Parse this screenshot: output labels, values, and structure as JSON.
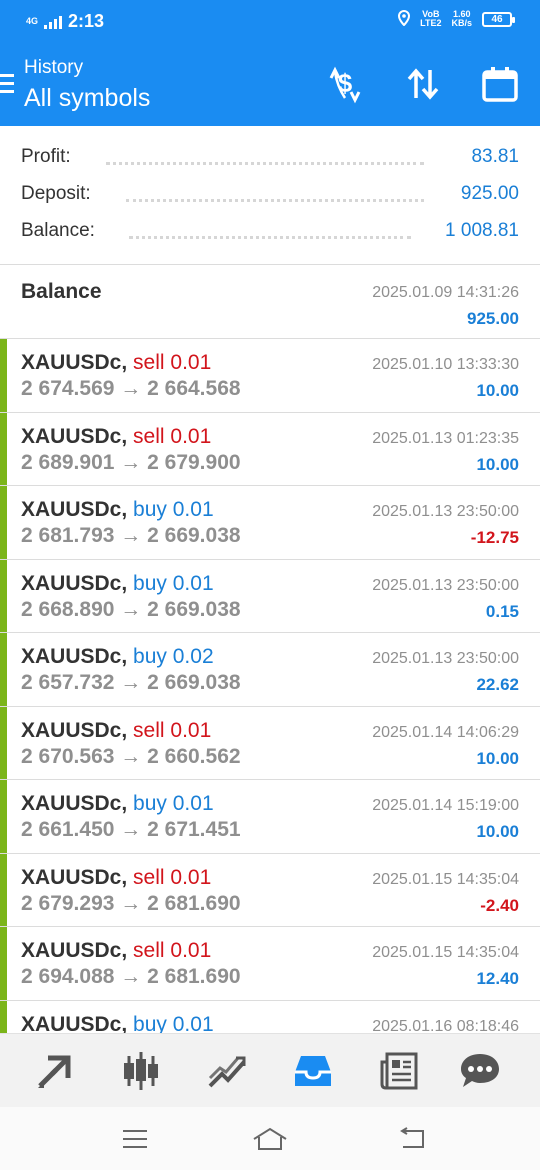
{
  "status_bar": {
    "network": "4G",
    "time": "2:13",
    "volte": "VoB\nLTE2",
    "speed": "1.60\nKB/s",
    "battery": "46"
  },
  "header": {
    "subtitle": "History",
    "title": "All symbols",
    "icons": [
      "currency-exchange-icon",
      "sort-arrows-icon",
      "calendar-icon"
    ]
  },
  "summary": {
    "profit_label": "Profit:",
    "profit_value": "83.81",
    "deposit_label": "Deposit:",
    "deposit_value": "925.00",
    "balance_label": "Balance:",
    "balance_value": "1 008.81"
  },
  "balance_entry": {
    "title": "Balance",
    "time": "2025.01.09 14:31:26",
    "amount": "925.00"
  },
  "trades": [
    {
      "symbol": "XAUUSDc,",
      "side": "sell",
      "volume": "0.01",
      "open": "2 674.569",
      "arrow": "→",
      "close": "2 664.568",
      "time": "2025.01.10 13:33:30",
      "profit": "10.00"
    },
    {
      "symbol": "XAUUSDc,",
      "side": "sell",
      "volume": "0.01",
      "open": "2 689.901",
      "arrow": "→",
      "close": "2 679.900",
      "time": "2025.01.13 01:23:35",
      "profit": "10.00"
    },
    {
      "symbol": "XAUUSDc,",
      "side": "buy",
      "volume": "0.01",
      "open": "2 681.793",
      "arrow": "→",
      "close": "2 669.038",
      "time": "2025.01.13 23:50:00",
      "profit": "-12.75"
    },
    {
      "symbol": "XAUUSDc,",
      "side": "buy",
      "volume": "0.01",
      "open": "2 668.890",
      "arrow": "→",
      "close": "2 669.038",
      "time": "2025.01.13 23:50:00",
      "profit": "0.15"
    },
    {
      "symbol": "XAUUSDc,",
      "side": "buy",
      "volume": "0.02",
      "open": "2 657.732",
      "arrow": "→",
      "close": "2 669.038",
      "time": "2025.01.13 23:50:00",
      "profit": "22.62"
    },
    {
      "symbol": "XAUUSDc,",
      "side": "sell",
      "volume": "0.01",
      "open": "2 670.563",
      "arrow": "→",
      "close": "2 660.562",
      "time": "2025.01.14 14:06:29",
      "profit": "10.00"
    },
    {
      "symbol": "XAUUSDc,",
      "side": "buy",
      "volume": "0.01",
      "open": "2 661.450",
      "arrow": "→",
      "close": "2 671.451",
      "time": "2025.01.14 15:19:00",
      "profit": "10.00"
    },
    {
      "symbol": "XAUUSDc,",
      "side": "sell",
      "volume": "0.01",
      "open": "2 679.293",
      "arrow": "→",
      "close": "2 681.690",
      "time": "2025.01.15 14:35:04",
      "profit": "-2.40"
    },
    {
      "symbol": "XAUUSDc,",
      "side": "sell",
      "volume": "0.01",
      "open": "2 694.088",
      "arrow": "→",
      "close": "2 681.690",
      "time": "2025.01.15 14:35:04",
      "profit": "12.40"
    },
    {
      "symbol": "XAUUSDc,",
      "side": "buy",
      "volume": "0.01",
      "open": "",
      "arrow": "",
      "close": "",
      "time": "2025.01.16 08:18:46",
      "profit": ""
    }
  ],
  "bottom_nav": {
    "items": [
      "quotes-arrows-icon",
      "chart-candles-icon",
      "trade-trend-icon",
      "history-inbox-icon",
      "news-icon",
      "chat-icon"
    ],
    "active": "history-inbox-icon",
    "active_color": "#1a8cf2",
    "inactive_color": "#555555"
  },
  "system_nav": {
    "items": [
      "menu-icon",
      "home-icon",
      "back-icon"
    ]
  },
  "colors": {
    "header_bg": "#1a8cf2",
    "profit_blue": "#1a7fd6",
    "sell_red": "#d2151c",
    "closed_bar_green": "#7bb51a"
  }
}
